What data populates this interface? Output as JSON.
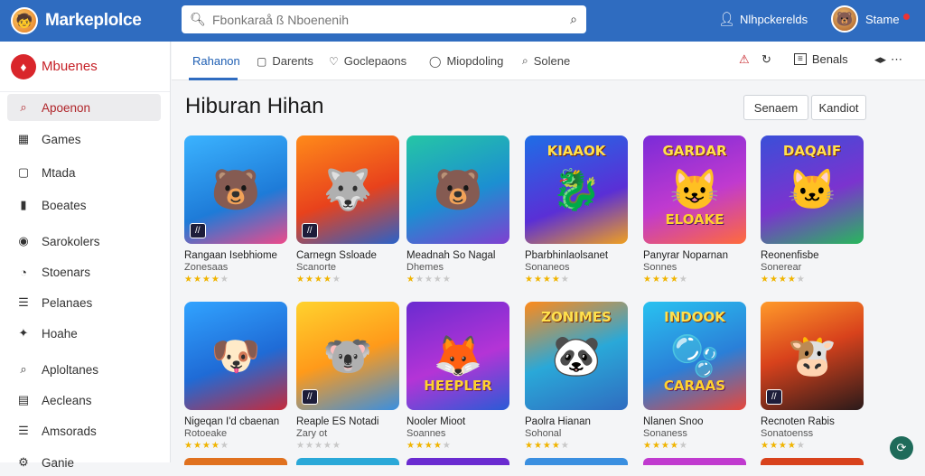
{
  "app": {
    "name": "Markeplolce",
    "search_placeholder": "Fbonkaraå ß Nboenenih",
    "user_label": "Nlhpckerelds",
    "profile_label": "Stame"
  },
  "sidebar": {
    "header": "Mbuenes",
    "items": [
      {
        "label": "Apoenon",
        "icon": "search-icon"
      },
      {
        "label": "Games",
        "icon": "gamepad-icon"
      },
      {
        "label": "Mtada",
        "icon": "media-icon"
      },
      {
        "label": "Boeates",
        "icon": "bookmark-icon"
      },
      {
        "label": "Sarokolers",
        "icon": "user-icon"
      },
      {
        "label": "Stoenars",
        "icon": "bell-icon"
      },
      {
        "label": "Pelanaes",
        "icon": "list-icon"
      },
      {
        "label": "Hoahe",
        "icon": "pin-icon"
      },
      {
        "label": "Aploltanes",
        "icon": "search-icon"
      },
      {
        "label": "Aecleans",
        "icon": "document-icon"
      },
      {
        "label": "Amsorads",
        "icon": "list-icon"
      },
      {
        "label": "Ganie",
        "icon": "settings-icon"
      }
    ]
  },
  "tabs": [
    {
      "label": "Rahanon",
      "icon": ""
    },
    {
      "label": "Darents",
      "icon": "square-icon"
    },
    {
      "label": "Goclepaons",
      "icon": "heart-icon"
    },
    {
      "label": "Miopdoling",
      "icon": "circle-icon"
    },
    {
      "label": "Solene",
      "icon": "search-icon"
    }
  ],
  "toolbar_right": {
    "filter_label": "Benals"
  },
  "main": {
    "title": "Hiburan Hihan",
    "btn_primary": "Senaem",
    "btn_secondary": "Kandiot"
  },
  "apps_row1": [
    {
      "title": "Rangaan Isebhiome",
      "sub": "Zonesaas",
      "rating": 4,
      "badge": "//",
      "art": "🐻",
      "bg": "linear-gradient(160deg,#3bb3ff,#1e7bd8 60%,#ef4a8a)"
    },
    {
      "title": "Carnegn Ssloade",
      "sub": "Scanorte",
      "rating": 4,
      "badge": "//",
      "art": "🐺",
      "bg": "linear-gradient(160deg,#ff8a1a,#e8421c 55%,#2a62c9)"
    },
    {
      "title": "Meadnah So Nagal",
      "sub": "Dhemes",
      "rating": 1,
      "badge": "",
      "art": "🐻",
      "bg": "linear-gradient(160deg,#25c6a5,#1c8fd1 55%,#7f3fd1)"
    },
    {
      "title": "Pbarbhinlaolsanet",
      "sub": "Sonaneos",
      "rating": 4,
      "badge": "",
      "art": "🐉",
      "bg": "linear-gradient(160deg,#1e6ee6,#5a2fd6 60%,#f0a020)",
      "banner": "KIAAOK"
    },
    {
      "title": "Panyrar Noparnan",
      "sub": "Sonnes",
      "rating": 4,
      "badge": "",
      "art": "😺",
      "bg": "linear-gradient(160deg,#7a2bd8,#c03acf 55%,#ff6b3b)",
      "banner": "GARDAR",
      "banner2": "ELOAKE"
    },
    {
      "title": "Reonenfisbe",
      "sub": "Sonerear",
      "rating": 4,
      "badge": "",
      "art": "🐱",
      "bg": "linear-gradient(160deg,#3a4fd8,#7b33cf 55%,#28b85c)",
      "banner": "DAQAIF"
    }
  ],
  "apps_row2": [
    {
      "title": "Nigeqan I'd cbaenan",
      "sub": "Rotoeake",
      "rating": 4,
      "badge": "",
      "art": "🐶",
      "bg": "linear-gradient(160deg,#31a3ff,#1f6bd6 55%,#c62b3c)"
    },
    {
      "title": "Reaple ES Notadi",
      "sub": "Zary ot",
      "rating": 0,
      "badge": "//",
      "art": "🐨",
      "bg": "linear-gradient(160deg,#ffd22e,#ff9a1a 50%,#3a8fe0)"
    },
    {
      "title": "Nooler Mioot",
      "sub": "Soannes",
      "rating": 4,
      "badge": "",
      "art": "🦊",
      "bg": "linear-gradient(160deg,#6a2bd0,#b434d6 55%,#2a5bd6)",
      "banner2": "HEEPLER"
    },
    {
      "title": "Paolra Hianan",
      "sub": "Sohonal",
      "rating": 4,
      "badge": "",
      "art": "🐼",
      "bg": "linear-gradient(160deg,#ff8a1a,#2aa8d8 50%,#2f6cc0)",
      "banner": "ZONIMES"
    },
    {
      "title": "Nlanen Snoo",
      "sub": "Sonaness",
      "rating": 4,
      "badge": "",
      "art": "🫧",
      "bg": "linear-gradient(160deg,#29c2f0,#2a7fd8 55%,#e8473c)",
      "banner": "INDOOK",
      "banner2": "CARAAS"
    },
    {
      "title": "Recnoten Rabis",
      "sub": "Sonatoenss",
      "rating": 4,
      "badge": "//",
      "art": "🐮",
      "bg": "linear-gradient(160deg,#ff9a2a,#d8421c 45%,#2a1a1a)"
    }
  ],
  "peek_colors": [
    "#e0711f",
    "#2aa8d8",
    "#6a2bd0",
    "#3a8fe0",
    "#c03acf",
    "#d8421c"
  ]
}
